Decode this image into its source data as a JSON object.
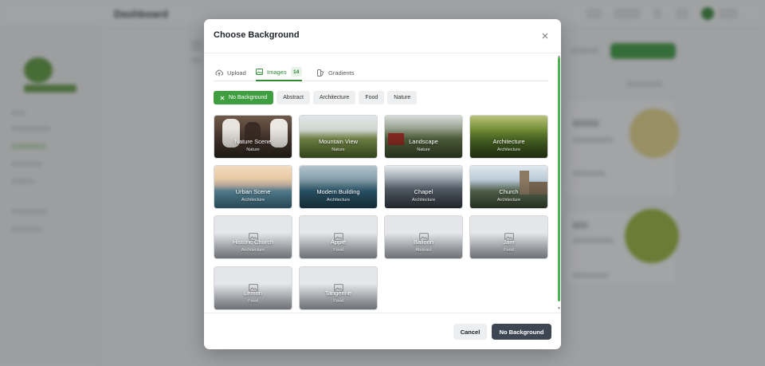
{
  "background_app": {
    "title": "Dashboard"
  },
  "modal": {
    "title": "Choose Background",
    "tabs": [
      {
        "label": "Upload",
        "icon": "upload-icon",
        "active": false
      },
      {
        "label": "Images",
        "icon": "image-icon",
        "active": true,
        "count": "14"
      },
      {
        "label": "Gradients",
        "icon": "gradient-icon",
        "active": false
      }
    ],
    "filters": [
      {
        "label": "No Background",
        "active": true
      },
      {
        "label": "Abstract",
        "active": false
      },
      {
        "label": "Architecture",
        "active": false
      },
      {
        "label": "Food",
        "active": false
      },
      {
        "label": "Nature",
        "active": false
      }
    ],
    "images": [
      {
        "name": "Nature Scene",
        "category": "Nature",
        "style": "cows"
      },
      {
        "name": "Mountain View",
        "category": "Nature",
        "style": "field"
      },
      {
        "name": "Landscape",
        "category": "Nature",
        "style": "barn"
      },
      {
        "name": "Architecture",
        "category": "Architecture",
        "style": "vineyard"
      },
      {
        "name": "Urban Scene",
        "category": "Architecture",
        "style": "sunset"
      },
      {
        "name": "Modern Building",
        "category": "Architecture",
        "style": "ocean"
      },
      {
        "name": "Chapel",
        "category": "Architecture",
        "style": "mountains"
      },
      {
        "name": "Church",
        "category": "Architecture",
        "style": "church"
      },
      {
        "name": "Historic Church",
        "category": "Architecture",
        "style": "placeholder"
      },
      {
        "name": "Apple",
        "category": "Food",
        "style": "placeholder"
      },
      {
        "name": "Balloon",
        "category": "Abstract",
        "style": "placeholder"
      },
      {
        "name": "Jam",
        "category": "Food",
        "style": "placeholder"
      },
      {
        "name": "Lemon",
        "category": "Food",
        "style": "placeholder"
      },
      {
        "name": "Tangerine",
        "category": "Food",
        "style": "placeholder"
      }
    ],
    "footer": {
      "cancel_label": "Cancel",
      "primary_label": "No Background"
    }
  },
  "colors": {
    "accent": "#3f9e40",
    "primary_button": "#3e4654"
  }
}
